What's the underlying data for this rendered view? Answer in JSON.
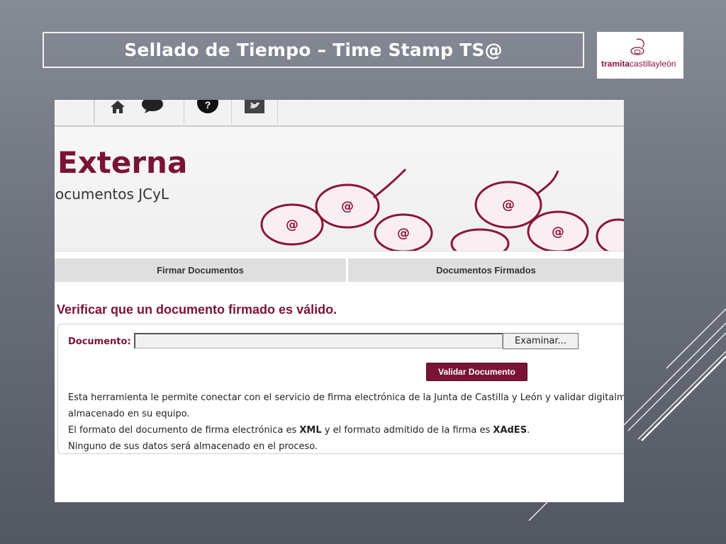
{
  "slide": {
    "title": "Sellado de Tiempo – Time Stamp TS@",
    "logo": {
      "text_bold": "tramita",
      "text_regular": "castillayleón"
    }
  },
  "app": {
    "nav_icons": [
      "home-icon",
      "faq-icon",
      "help-icon",
      "twitter-icon"
    ],
    "nav_faq_label": "FAQ",
    "banner": {
      "title": "Externa",
      "subtitle": "ocumentos JCyL"
    },
    "tabs": [
      {
        "label": "Firmar Documentos"
      },
      {
        "label": "Documentos Firmados"
      }
    ],
    "verify_title": "Verificar que un documento firmado es válido.",
    "form": {
      "document_label": "Documento:",
      "document_value": "",
      "browse_label": "Examinar...",
      "validate_label": "Validar Documento"
    },
    "info": {
      "line1": "Esta herramienta le permite conectar con el servicio de firma electrónica de la Junta de Castilla y León y validar digitalm",
      "line2": "almacenado en su equipo.",
      "line3_pre": "El formato del documento de firma electrónica es ",
      "line3_xml": "XML",
      "line3_mid": " y el formato admitido de la firma es ",
      "line3_xades": "XAdES",
      "line3_post": ".",
      "line4": "Ninguno de sus datos será almacenado en el proceso."
    }
  },
  "colors": {
    "brand": "#7a1435",
    "background": "#6c717c"
  }
}
